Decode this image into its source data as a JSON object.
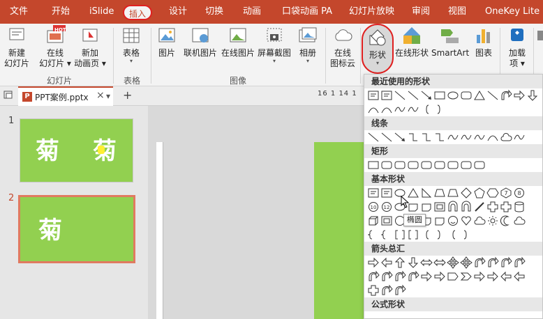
{
  "tabs": [
    "文件",
    "开始",
    "iSlide",
    "插入",
    "设计",
    "切换",
    "动画",
    "口袋动画 PA",
    "幻灯片放映",
    "审阅",
    "视图",
    "OneKey Lite"
  ],
  "ribbon": {
    "new_slide": [
      "新建",
      "幻灯片"
    ],
    "online_slide": [
      "在线",
      "幻灯片"
    ],
    "new_anim_page": [
      "新加",
      "动画页"
    ],
    "hot_badge": "HOT",
    "table": "表格",
    "picture": "图片",
    "online_picture": "联机图片",
    "online_picture2": "在线图片",
    "screenshot": "屏幕截图",
    "album": "相册",
    "online_icons": [
      "在线",
      "图标云"
    ],
    "shapes": "形状",
    "online_shapes": "在线形状",
    "smartart": "SmartArt",
    "chart": "图表",
    "addins": [
      "加载",
      "项"
    ],
    "groups": {
      "slides": "幻灯片",
      "tables": "表格",
      "images": "图像"
    }
  },
  "doc_tab": {
    "filename": "PPT案例.pptx",
    "close": "×",
    "new": "+"
  },
  "ruler_label": "16 1 14 1",
  "thumbs": [
    {
      "num": "1",
      "text1": "菊",
      "text2": "菊"
    },
    {
      "num": "2",
      "text1": "菊"
    }
  ],
  "shape_menu": {
    "sections": [
      "最近使用的形状",
      "线条",
      "矩形",
      "基本形状",
      "箭头总汇",
      "公式形状"
    ],
    "tooltip": "椭圆",
    "sym": {
      "brace_l": "{",
      "brace_r": "}"
    }
  },
  "colors": {
    "accent": "#c4472c",
    "slide_green": "#92d050",
    "highlight_red": "#e02020"
  }
}
